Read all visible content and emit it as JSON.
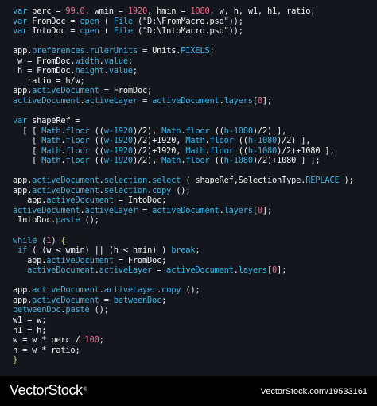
{
  "colors": {
    "background": "#13161c",
    "footer_background": "#000000",
    "keyword": "#3bb3e5",
    "number": "#ee6b8e",
    "plain": "#f2f2f2",
    "brace": "#bfe44a"
  },
  "code_lines": [
    [
      [
        "kw",
        "var"
      ],
      [
        "plain",
        " perc = "
      ],
      [
        "num",
        "99.0"
      ],
      [
        "plain",
        ", wmin = "
      ],
      [
        "num",
        "1920"
      ],
      [
        "plain",
        ", hmin = "
      ],
      [
        "num",
        "1080"
      ],
      [
        "plain",
        ", w, h, w1, h1, ratio;"
      ]
    ],
    [
      [
        "kw",
        "var"
      ],
      [
        "plain",
        " FromDoc = "
      ],
      [
        "fn",
        "open"
      ],
      [
        "plain",
        " ( "
      ],
      [
        "builtin",
        "File"
      ],
      [
        "plain",
        " (\"D:\\FromMacro.psd\"));"
      ]
    ],
    [
      [
        "kw",
        "var"
      ],
      [
        "plain",
        " IntoDoc = "
      ],
      [
        "fn",
        "open"
      ],
      [
        "plain",
        " ( "
      ],
      [
        "builtin",
        "File"
      ],
      [
        "plain",
        " (\"D:\\IntoMacro.psd\"));"
      ]
    ],
    [],
    [
      [
        "plain",
        "app."
      ],
      [
        "prop",
        "preferences"
      ],
      [
        "plain",
        "."
      ],
      [
        "prop",
        "rulerUnits"
      ],
      [
        "plain",
        " = Units."
      ],
      [
        "prop",
        "PIXELS"
      ],
      [
        "plain",
        ";"
      ]
    ],
    [
      [
        "plain",
        " w = FromDoc."
      ],
      [
        "prop",
        "width"
      ],
      [
        "plain",
        "."
      ],
      [
        "prop",
        "value"
      ],
      [
        "plain",
        ";"
      ]
    ],
    [
      [
        "plain",
        " h = FromDoc."
      ],
      [
        "prop",
        "height"
      ],
      [
        "plain",
        "."
      ],
      [
        "prop",
        "value"
      ],
      [
        "plain",
        ";"
      ]
    ],
    [
      [
        "plain",
        "   ratio = h/w;"
      ]
    ],
    [
      [
        "plain",
        "app."
      ],
      [
        "prop",
        "activeDocument"
      ],
      [
        "plain",
        " = FromDoc;"
      ]
    ],
    [
      [
        "prop",
        "activeDocument"
      ],
      [
        "plain",
        "."
      ],
      [
        "prop",
        "activeLayer"
      ],
      [
        "plain",
        " = "
      ],
      [
        "prop",
        "activeDocument"
      ],
      [
        "plain",
        "."
      ],
      [
        "prop",
        "layers"
      ],
      [
        "plain",
        "["
      ],
      [
        "num",
        "0"
      ],
      [
        "plain",
        "];"
      ]
    ],
    [],
    [
      [
        "kw",
        "var"
      ],
      [
        "plain",
        " shapeRef ="
      ]
    ],
    [
      [
        "plain",
        "  [ [ "
      ],
      [
        "builtin",
        "Math"
      ],
      [
        "plain",
        "."
      ],
      [
        "fn",
        "floor"
      ],
      [
        "plain",
        " (("
      ],
      [
        "kw",
        "w-1920"
      ],
      [
        "plain",
        ")/2), "
      ],
      [
        "builtin",
        "Math"
      ],
      [
        "plain",
        "."
      ],
      [
        "fn",
        "floor"
      ],
      [
        "plain",
        " (("
      ],
      [
        "kw",
        "h-1080"
      ],
      [
        "plain",
        ")/2) ],"
      ]
    ],
    [
      [
        "plain",
        "    [ "
      ],
      [
        "builtin",
        "Math"
      ],
      [
        "plain",
        "."
      ],
      [
        "fn",
        "floor"
      ],
      [
        "plain",
        " (("
      ],
      [
        "kw",
        "w-1920"
      ],
      [
        "plain",
        ")/2)+1920, "
      ],
      [
        "builtin",
        "Math"
      ],
      [
        "plain",
        "."
      ],
      [
        "fn",
        "floor"
      ],
      [
        "plain",
        " (("
      ],
      [
        "kw",
        "h-1080"
      ],
      [
        "plain",
        ")/2) ],"
      ]
    ],
    [
      [
        "plain",
        "    [ "
      ],
      [
        "builtin",
        "Math"
      ],
      [
        "plain",
        "."
      ],
      [
        "fn",
        "floor"
      ],
      [
        "plain",
        " (("
      ],
      [
        "kw",
        "w-1920"
      ],
      [
        "plain",
        ")/2)+1920, "
      ],
      [
        "builtin",
        "Math"
      ],
      [
        "plain",
        "."
      ],
      [
        "fn",
        "floor"
      ],
      [
        "plain",
        " (("
      ],
      [
        "kw",
        "h-1080"
      ],
      [
        "plain",
        ")/2)+1080 ],"
      ]
    ],
    [
      [
        "plain",
        "    [ "
      ],
      [
        "builtin",
        "Math"
      ],
      [
        "plain",
        "."
      ],
      [
        "fn",
        "floor"
      ],
      [
        "plain",
        " (("
      ],
      [
        "kw",
        "w-1920"
      ],
      [
        "plain",
        ")/2), "
      ],
      [
        "builtin",
        "Math"
      ],
      [
        "plain",
        "."
      ],
      [
        "fn",
        "floor"
      ],
      [
        "plain",
        " (("
      ],
      [
        "kw",
        "h-1080"
      ],
      [
        "plain",
        ")/2)+1080 ] ];"
      ]
    ],
    [],
    [
      [
        "plain",
        "app."
      ],
      [
        "prop",
        "activeDocument"
      ],
      [
        "plain",
        "."
      ],
      [
        "prop",
        "selection"
      ],
      [
        "plain",
        "."
      ],
      [
        "fn",
        "select"
      ],
      [
        "plain",
        " ( shapeRef,SelectionType."
      ],
      [
        "prop",
        "REPLACE"
      ],
      [
        "plain",
        " );"
      ]
    ],
    [
      [
        "plain",
        "app."
      ],
      [
        "prop",
        "activeDocument"
      ],
      [
        "plain",
        "."
      ],
      [
        "prop",
        "selection"
      ],
      [
        "plain",
        "."
      ],
      [
        "fn",
        "copy"
      ],
      [
        "plain",
        " ();"
      ]
    ],
    [
      [
        "plain",
        "   app."
      ],
      [
        "prop",
        "activeDocument"
      ],
      [
        "plain",
        " = IntoDoc;"
      ]
    ],
    [
      [
        "prop",
        "activeDocument"
      ],
      [
        "plain",
        "."
      ],
      [
        "prop",
        "activeLayer"
      ],
      [
        "plain",
        " = "
      ],
      [
        "prop",
        "activeDocument"
      ],
      [
        "plain",
        "."
      ],
      [
        "prop",
        "layers"
      ],
      [
        "plain",
        "["
      ],
      [
        "num",
        "0"
      ],
      [
        "plain",
        "];"
      ]
    ],
    [
      [
        "plain",
        " IntoDoc."
      ],
      [
        "fn",
        "paste"
      ],
      [
        "plain",
        " ();"
      ]
    ],
    [],
    [
      [
        "kw",
        "while"
      ],
      [
        "plain",
        " ("
      ],
      [
        "num",
        "1"
      ],
      [
        "plain",
        ") "
      ],
      [
        "brace",
        "{"
      ]
    ],
    [
      [
        "plain",
        " "
      ],
      [
        "kw",
        "if"
      ],
      [
        "plain",
        " ( (w < wmin) || (h < hmin) ) "
      ],
      [
        "kw",
        "break"
      ],
      [
        "plain",
        ";"
      ]
    ],
    [
      [
        "plain",
        "   app."
      ],
      [
        "prop",
        "activeDocument"
      ],
      [
        "plain",
        " = FromDoc;"
      ]
    ],
    [
      [
        "plain",
        "   "
      ],
      [
        "prop",
        "activeDocument"
      ],
      [
        "plain",
        "."
      ],
      [
        "prop",
        "activeLayer"
      ],
      [
        "plain",
        " = "
      ],
      [
        "prop",
        "activeDocument"
      ],
      [
        "plain",
        "."
      ],
      [
        "prop",
        "layers"
      ],
      [
        "plain",
        "["
      ],
      [
        "num",
        "0"
      ],
      [
        "plain",
        "];"
      ]
    ],
    [],
    [
      [
        "plain",
        "app."
      ],
      [
        "prop",
        "activeDocument"
      ],
      [
        "plain",
        "."
      ],
      [
        "prop",
        "activeLayer"
      ],
      [
        "plain",
        "."
      ],
      [
        "fn",
        "copy"
      ],
      [
        "plain",
        " ();"
      ]
    ],
    [
      [
        "plain",
        "app."
      ],
      [
        "prop",
        "activeDocument"
      ],
      [
        "plain",
        " = "
      ],
      [
        "prop",
        "betweenDoc"
      ],
      [
        "plain",
        ";"
      ]
    ],
    [
      [
        "prop",
        "betweenDoc"
      ],
      [
        "plain",
        "."
      ],
      [
        "fn",
        "paste"
      ],
      [
        "plain",
        " ();"
      ]
    ],
    [
      [
        "plain",
        "w1 = w;"
      ]
    ],
    [
      [
        "plain",
        "h1 = h;"
      ]
    ],
    [
      [
        "plain",
        "w = w * perc / "
      ],
      [
        "num",
        "100"
      ],
      [
        "plain",
        ";"
      ]
    ],
    [
      [
        "plain",
        "h = w * ratio;"
      ]
    ],
    [
      [
        "brace",
        "}"
      ]
    ]
  ],
  "footer": {
    "logo_text": "VectorStock",
    "logo_mark": "®",
    "url": "VectorStock.com/19533161"
  }
}
